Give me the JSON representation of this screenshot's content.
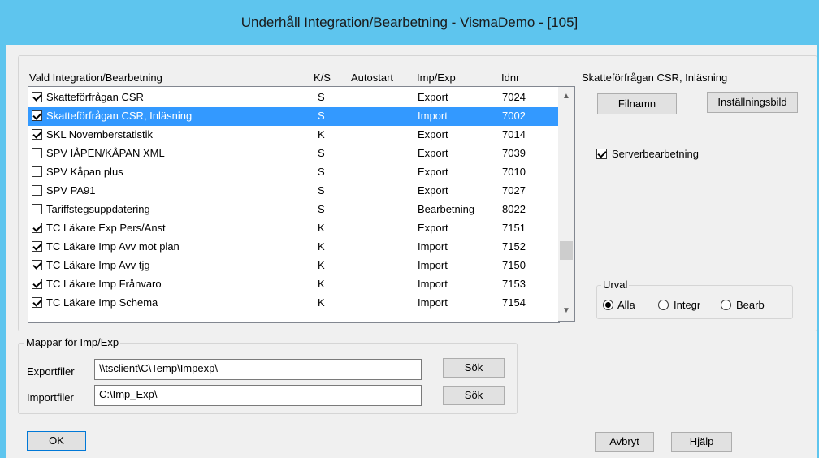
{
  "window": {
    "title": "Underhåll Integration/Bearbetning - VismaDemo - [105]"
  },
  "list": {
    "headers": {
      "name": "Vald Integration/Bearbetning",
      "ks": "K/S",
      "autostart": "Autostart",
      "impexp": "Imp/Exp",
      "idnr": "Idnr"
    },
    "rows": [
      {
        "checked": true,
        "name": "Skatteförfrågan CSR",
        "ks": "S",
        "autostart": "",
        "impexp": "Export",
        "idnr": "7024",
        "selected": false
      },
      {
        "checked": true,
        "name": "Skatteförfrågan CSR, Inläsning",
        "ks": "S",
        "autostart": "",
        "impexp": "Import",
        "idnr": "7002",
        "selected": true
      },
      {
        "checked": true,
        "name": "SKL Novemberstatistik",
        "ks": "K",
        "autostart": "",
        "impexp": "Export",
        "idnr": "7014",
        "selected": false
      },
      {
        "checked": false,
        "name": "SPV IÅPEN/KÅPAN XML",
        "ks": "S",
        "autostart": "",
        "impexp": "Export",
        "idnr": "7039",
        "selected": false
      },
      {
        "checked": false,
        "name": "SPV Kåpan plus",
        "ks": "S",
        "autostart": "",
        "impexp": "Export",
        "idnr": "7010",
        "selected": false
      },
      {
        "checked": false,
        "name": "SPV PA91",
        "ks": "S",
        "autostart": "",
        "impexp": "Export",
        "idnr": "7027",
        "selected": false
      },
      {
        "checked": false,
        "name": "Tariffstegsuppdatering",
        "ks": "S",
        "autostart": "",
        "impexp": "Bearbetning",
        "idnr": "8022",
        "selected": false
      },
      {
        "checked": true,
        "name": "TC Läkare Exp Pers/Anst",
        "ks": "K",
        "autostart": "",
        "impexp": "Export",
        "idnr": "7151",
        "selected": false
      },
      {
        "checked": true,
        "name": "TC Läkare Imp Avv mot plan",
        "ks": "K",
        "autostart": "",
        "impexp": "Import",
        "idnr": "7152",
        "selected": false
      },
      {
        "checked": true,
        "name": "TC Läkare Imp Avv tjg",
        "ks": "K",
        "autostart": "",
        "impexp": "Import",
        "idnr": "7150",
        "selected": false
      },
      {
        "checked": true,
        "name": "TC Läkare Imp Frånvaro",
        "ks": "K",
        "autostart": "",
        "impexp": "Import",
        "idnr": "7153",
        "selected": false
      },
      {
        "checked": true,
        "name": "TC Läkare Imp Schema",
        "ks": "K",
        "autostart": "",
        "impexp": "Import",
        "idnr": "7154",
        "selected": false
      }
    ]
  },
  "side": {
    "heading": "Skatteförfrågan CSR, Inläsning",
    "filnamn_label": "Filnamn",
    "installningsbild_label": "Inställningsbild",
    "serverbearbetning_label": "Serverbearbetning",
    "serverbearbetning_checked": true,
    "urval": {
      "legend": "Urval",
      "options": [
        {
          "label": "Alla",
          "selected": true
        },
        {
          "label": "Integr",
          "selected": false
        },
        {
          "label": "Bearb",
          "selected": false
        }
      ]
    }
  },
  "folders": {
    "legend": "Mappar för Imp/Exp",
    "export_label": "Exportfiler",
    "export_value": "\\\\tsclient\\C\\Temp\\Impexp\\",
    "import_label": "Importfiler",
    "import_value": "C:\\Imp_Exp\\",
    "sok_label": "Sök"
  },
  "footer": {
    "ok_label": "OK",
    "avbryt_label": "Avbryt",
    "hjalp_label": "Hjälp"
  }
}
